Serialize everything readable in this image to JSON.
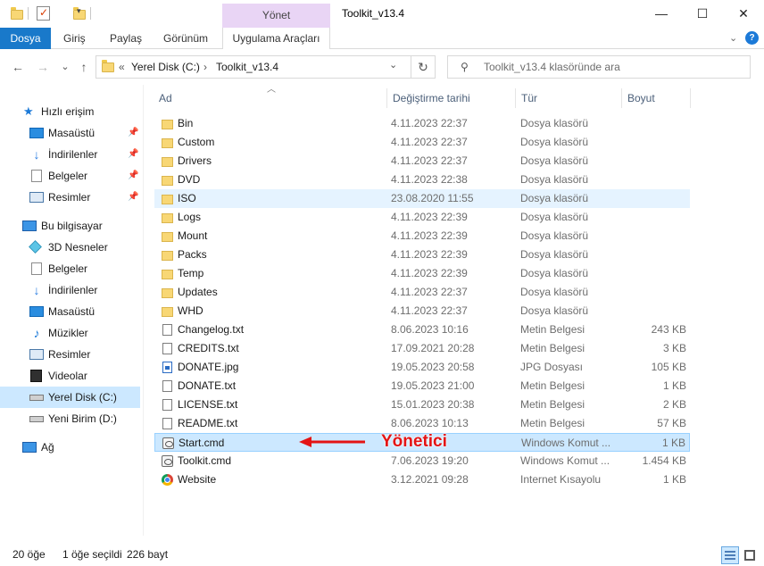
{
  "window": {
    "title": "Toolkit_v13.4",
    "manage_context": "Yönet",
    "minimize": "—",
    "maximize": "☐",
    "close": "✕"
  },
  "ribbon": {
    "tabs": [
      "Dosya",
      "Giriş",
      "Paylaş",
      "Görünüm"
    ],
    "context_tab": "Uygulama Araçları",
    "expand_icon": "chevron-down-icon",
    "help_icon": "help-icon"
  },
  "address": {
    "back": "←",
    "forward": "→",
    "recent": "⌄",
    "up": "↑",
    "overflow": "«",
    "crumbs": [
      "Yerel Disk (C:)",
      "Toolkit_v13.4"
    ],
    "separator": "›",
    "search_placeholder": "Toolkit_v13.4 klasöründe ara"
  },
  "nav": {
    "quick_access": {
      "label": "Hızlı erişim",
      "items": [
        {
          "label": "Masaüstü",
          "icon": "desktop-icon",
          "pinned": true
        },
        {
          "label": "İndirilenler",
          "icon": "download-icon",
          "pinned": true
        },
        {
          "label": "Belgeler",
          "icon": "documents-icon",
          "pinned": true
        },
        {
          "label": "Resimler",
          "icon": "pictures-icon",
          "pinned": true
        }
      ]
    },
    "this_pc": {
      "label": "Bu bilgisayar",
      "items": [
        {
          "label": "3D Nesneler",
          "icon": "3d-objects-icon"
        },
        {
          "label": "Belgeler",
          "icon": "documents-icon"
        },
        {
          "label": "İndirilenler",
          "icon": "download-icon"
        },
        {
          "label": "Masaüstü",
          "icon": "desktop-icon"
        },
        {
          "label": "Müzikler",
          "icon": "music-icon"
        },
        {
          "label": "Resimler",
          "icon": "pictures-icon"
        },
        {
          "label": "Videolar",
          "icon": "videos-icon"
        },
        {
          "label": "Yerel Disk (C:)",
          "icon": "drive-icon",
          "selected": true
        },
        {
          "label": "Yeni Birim (D:)",
          "icon": "drive-icon"
        }
      ]
    },
    "network": {
      "label": "Ağ",
      "icon": "network-icon"
    }
  },
  "columns": {
    "name": "Ad",
    "date": "Değiştirme tarihi",
    "type": "Tür",
    "size": "Boyut"
  },
  "files": [
    {
      "name": "Bin",
      "date": "4.11.2023 22:37",
      "type": "Dosya klasörü",
      "size": "",
      "kind": "folder"
    },
    {
      "name": "Custom",
      "date": "4.11.2023 22:37",
      "type": "Dosya klasörü",
      "size": "",
      "kind": "folder"
    },
    {
      "name": "Drivers",
      "date": "4.11.2023 22:37",
      "type": "Dosya klasörü",
      "size": "",
      "kind": "folder"
    },
    {
      "name": "DVD",
      "date": "4.11.2023 22:38",
      "type": "Dosya klasörü",
      "size": "",
      "kind": "folder"
    },
    {
      "name": "ISO",
      "date": "23.08.2020 11:55",
      "type": "Dosya klasörü",
      "size": "",
      "kind": "folder",
      "state": "hover"
    },
    {
      "name": "Logs",
      "date": "4.11.2023 22:39",
      "type": "Dosya klasörü",
      "size": "",
      "kind": "folder"
    },
    {
      "name": "Mount",
      "date": "4.11.2023 22:39",
      "type": "Dosya klasörü",
      "size": "",
      "kind": "folder"
    },
    {
      "name": "Packs",
      "date": "4.11.2023 22:39",
      "type": "Dosya klasörü",
      "size": "",
      "kind": "folder"
    },
    {
      "name": "Temp",
      "date": "4.11.2023 22:39",
      "type": "Dosya klasörü",
      "size": "",
      "kind": "folder"
    },
    {
      "name": "Updates",
      "date": "4.11.2023 22:37",
      "type": "Dosya klasörü",
      "size": "",
      "kind": "folder"
    },
    {
      "name": "WHD",
      "date": "4.11.2023 22:37",
      "type": "Dosya klasörü",
      "size": "",
      "kind": "folder"
    },
    {
      "name": "Changelog.txt",
      "date": "8.06.2023 10:16",
      "type": "Metin Belgesi",
      "size": "243 KB",
      "kind": "txt"
    },
    {
      "name": "CREDITS.txt",
      "date": "17.09.2021 20:28",
      "type": "Metin Belgesi",
      "size": "3 KB",
      "kind": "txt"
    },
    {
      "name": "DONATE.jpg",
      "date": "19.05.2023 20:58",
      "type": "JPG Dosyası",
      "size": "105 KB",
      "kind": "jpg"
    },
    {
      "name": "DONATE.txt",
      "date": "19.05.2023 21:00",
      "type": "Metin Belgesi",
      "size": "1 KB",
      "kind": "txt"
    },
    {
      "name": "LICENSE.txt",
      "date": "15.01.2023 20:38",
      "type": "Metin Belgesi",
      "size": "2 KB",
      "kind": "txt"
    },
    {
      "name": "README.txt",
      "date": "8.06.2023 10:13",
      "type": "Metin Belgesi",
      "size": "57 KB",
      "kind": "txt"
    },
    {
      "name": "Start.cmd",
      "date": "",
      "type": "Windows Komut ...",
      "size": "1 KB",
      "kind": "cmd",
      "state": "selected"
    },
    {
      "name": "Toolkit.cmd",
      "date": "7.06.2023 19:20",
      "type": "Windows Komut ...",
      "size": "1.454 KB",
      "kind": "cmd"
    },
    {
      "name": "Website",
      "date": "3.12.2021 09:28",
      "type": "Internet Kısayolu",
      "size": "1 KB",
      "kind": "url"
    }
  ],
  "annotation": {
    "label": "Yönetici",
    "color": "#e41414"
  },
  "status": {
    "count": "20 öğe",
    "selection": "1 öğe seçildi",
    "size": "226 bayt"
  },
  "colors": {
    "file_tab": "#1979ca",
    "context_tab": "#e9d5f5",
    "selection": "#cce8ff",
    "hover": "#e5f3ff"
  }
}
